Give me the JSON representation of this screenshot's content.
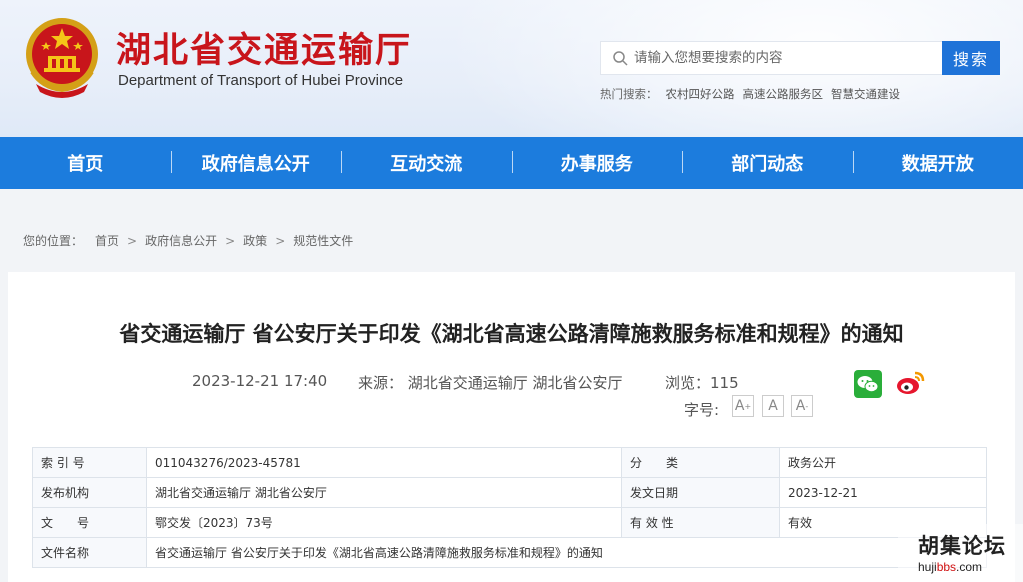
{
  "header": {
    "title": "湖北省交通运输厅",
    "subtitle": "Department of Transport of Hubei Province",
    "search": {
      "placeholder": "请输入您想要搜索的内容",
      "button": "搜索"
    },
    "hot_search": {
      "label": "热门搜索：",
      "items": [
        "农村四好公路",
        "高速公路服务区",
        "智慧交通建设"
      ]
    }
  },
  "nav": [
    "首页",
    "政府信息公开",
    "互动交流",
    "办事服务",
    "部门动态",
    "数据开放"
  ],
  "breadcrumb": {
    "label": "您的位置：",
    "items": [
      "首页",
      "政府信息公开",
      "政策",
      "规范性文件"
    ],
    "separator": ">"
  },
  "article": {
    "title": "省交通运输厅 省公安厅关于印发《湖北省高速公路清障施救服务标准和规程》的通知",
    "date": "2023-12-21 17:40",
    "source": "来源：  湖北省交通运输厅 湖北省公安厅",
    "views": "浏览：115",
    "font_size_label": "字号:",
    "font_buttons": [
      "A",
      "A",
      "A"
    ]
  },
  "info_table": {
    "rows": [
      [
        "索 引 号",
        "011043276/2023-45781",
        "分　　类",
        "政务公开"
      ],
      [
        "发布机构",
        "湖北省交通运输厅 湖北省公安厅",
        "发文日期",
        "2023-12-21"
      ],
      [
        "文　　号",
        "鄂交发〔2023〕73号",
        "有 效 性",
        "有效"
      ],
      [
        "文件名称",
        "省交通运输厅 省公安厅关于印发《湖北省高速公路清障施救服务标准和规程》的通知"
      ]
    ]
  },
  "watermark": {
    "text": "胡集论坛",
    "url_pre": "hujibbs",
    "url_red": "bbs",
    "url": "hujibbs.com"
  },
  "colors": {
    "brand_red": "#c8151b",
    "nav_blue": "#1c7cdd",
    "search_blue": "#1f73d8"
  }
}
